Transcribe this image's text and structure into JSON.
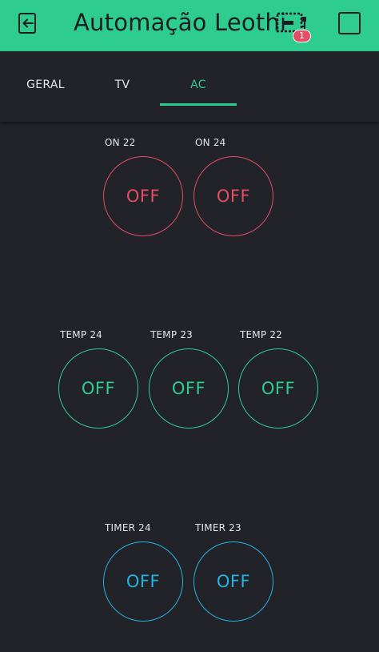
{
  "header": {
    "title": "Automação Leothi",
    "badge_count": "1",
    "back_icon": "exit-left-icon",
    "device_icon": "device-board-icon",
    "stop_icon": "stop-square-icon"
  },
  "tabs": [
    {
      "label": "GERAL",
      "active": false
    },
    {
      "label": "TV",
      "active": false
    },
    {
      "label": "AC",
      "active": true
    }
  ],
  "colors": {
    "header": "#2ecc8f",
    "background": "#212329",
    "red": "#e44d63",
    "green": "#2ecc8f",
    "blue": "#22b4e2"
  },
  "widgets": [
    {
      "label": "ON 22",
      "state": "OFF",
      "color": "red"
    },
    {
      "label": "ON 24",
      "state": "OFF",
      "color": "red"
    },
    {
      "label": "TEMP 24",
      "state": "OFF",
      "color": "green"
    },
    {
      "label": "TEMP 23",
      "state": "OFF",
      "color": "green"
    },
    {
      "label": "TEMP 22",
      "state": "OFF",
      "color": "green"
    },
    {
      "label": "TIMER 24",
      "state": "OFF",
      "color": "blue"
    },
    {
      "label": "TIMER 23",
      "state": "OFF",
      "color": "blue"
    }
  ]
}
